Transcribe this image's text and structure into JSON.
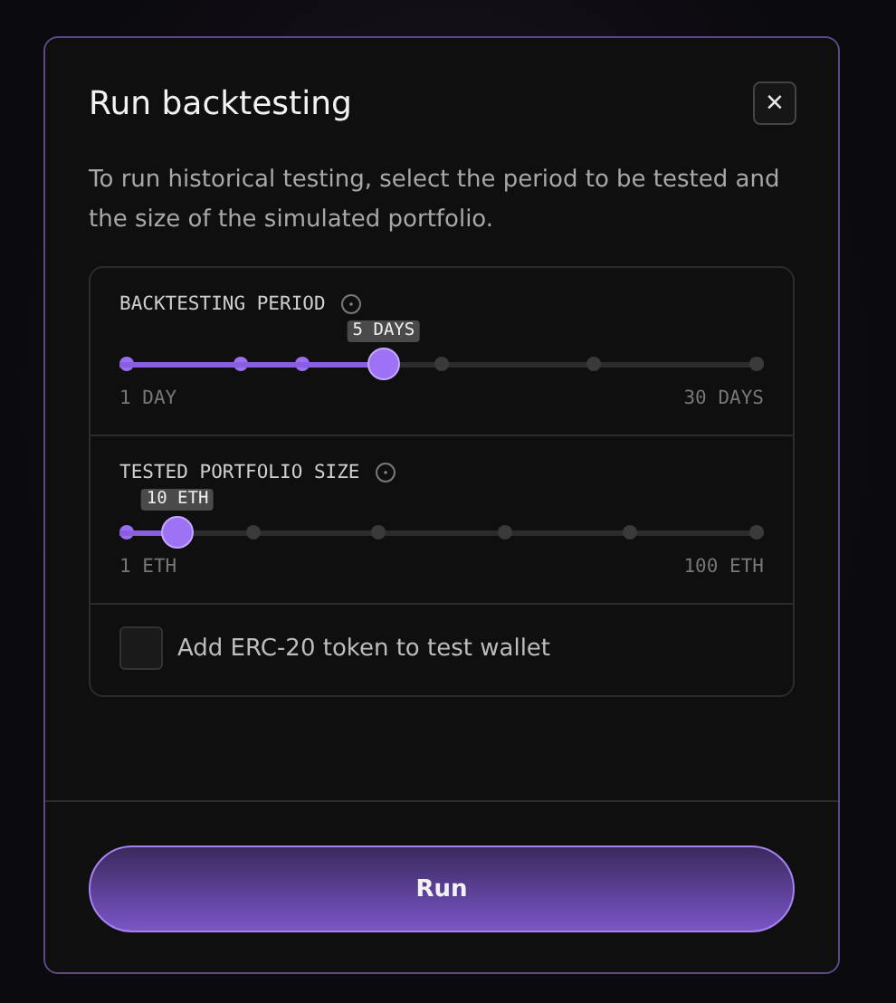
{
  "dialog": {
    "title": "Run backtesting",
    "close_icon": "×",
    "description": "To run historical testing, select the period to be tested and the size of the simulated portfolio."
  },
  "sliders": [
    {
      "label": "BACKTESTING PERIOD",
      "value_badge": "5 DAYS",
      "level": 0.41,
      "min_label": "1 DAY",
      "max_label": "30 DAYS"
    },
    {
      "label": "TESTED PORTFOLIO SIZE",
      "value_badge": "10 ETH",
      "level": 0.09,
      "min_label": "1 ETH",
      "max_label": "100 ETH"
    }
  ],
  "checkbox": {
    "label": "Add ERC-20 token to test wallet",
    "checked": false
  },
  "run_button": "Run"
}
